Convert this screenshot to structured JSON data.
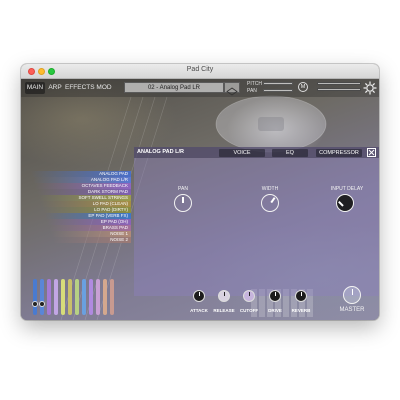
{
  "window": {
    "title": "Pad City"
  },
  "nav": {
    "tabs": [
      "MAIN",
      "ARP",
      "EFFECTS",
      "MOD"
    ],
    "active": "MAIN"
  },
  "preset": {
    "name": "02 - Analog Pad LR"
  },
  "header_controls": {
    "pitch_label": "PITCH",
    "pan_label": "PAN",
    "m_label": "M"
  },
  "panel": {
    "title": "ANALOG PAD L/R",
    "tabs": [
      "VOICE",
      "EQ",
      "COMPRESSOR"
    ],
    "active_tab": "VOICE",
    "knobs": [
      {
        "label": "PAN"
      },
      {
        "label": "WIDTH"
      },
      {
        "label": "INPUT DELAY"
      }
    ]
  },
  "presets_list": [
    {
      "name": "ANALOG PAD",
      "color": "#4a6fc8"
    },
    {
      "name": "ANALOG PAD L/R",
      "color": "#5b78d0"
    },
    {
      "name": "OCTAVES FEEDBACK",
      "color": "#8e66c0"
    },
    {
      "name": "DARK STORM PAD",
      "color": "#7e5fb0"
    },
    {
      "name": "SOFT SWELL STRINGS",
      "color": "#9c9c4c"
    },
    {
      "name": "LO PAD (CLEAN)",
      "color": "#a58d42"
    },
    {
      "name": "LO PAD (DIRTY)",
      "color": "#8b8e3f"
    },
    {
      "name": "EP PAD (VERB FX)",
      "color": "#3e78c6"
    },
    {
      "name": "EP PAD (OH)",
      "color": "#8b63b8"
    },
    {
      "name": "BRASS PAD",
      "color": "#a36e9c"
    },
    {
      "name": "NOISE 1",
      "color": "#b08a78"
    },
    {
      "name": "NOISE 2",
      "color": "#9c7a76"
    }
  ],
  "faders": {
    "colors": [
      "#4a7bd0",
      "#5a86d8",
      "#a57ad6",
      "#c2a6e4",
      "#d7dc7a",
      "#c9c06a",
      "#b7d084",
      "#6aa0e0",
      "#b08ae0",
      "#c8a0d4",
      "#d4a88e",
      "#c89a90"
    ]
  },
  "bottom_knobs": [
    {
      "label": "ATTACK"
    },
    {
      "label": "RELEASE"
    },
    {
      "label": "CUTOFF"
    },
    {
      "label": "DRIVE"
    },
    {
      "label": "REVERB"
    }
  ],
  "master": {
    "label": "MASTER"
  }
}
